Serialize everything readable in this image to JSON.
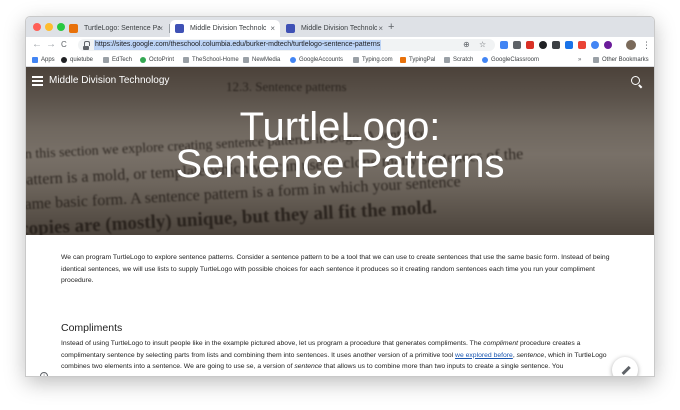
{
  "browser": {
    "tabs": [
      {
        "title": "TurtleLogo: Sentence Patterns",
        "close": "×",
        "active": false
      },
      {
        "title": "Middle Division Technology - T",
        "close": "×",
        "active": true
      },
      {
        "title": "Middle Division Technology - T",
        "close": "×",
        "active": false
      }
    ],
    "new_tab": "+",
    "back": "←",
    "forward": "→",
    "reload": "C",
    "url": "https://sites.google.com/theschool.columbia.edu/burker-mdtech/turtlelogo-sentence-patterns",
    "zoom_icon": "⊕",
    "star_icon": "☆",
    "menu": "⋮"
  },
  "bookmarks": [
    {
      "label": "Apps",
      "color": "#4285f4"
    },
    {
      "label": "quietube",
      "color": "#202124"
    },
    {
      "label": "EdTech",
      "color": "#9aa0a6"
    },
    {
      "label": "OctoPrint",
      "color": "#34a853"
    },
    {
      "label": "TheSchool-Home",
      "color": "#9aa0a6"
    },
    {
      "label": "NewMedia",
      "color": "#9aa0a6"
    },
    {
      "label": "GoogleAccounts",
      "color": "#4285f4"
    },
    {
      "label": "Typing.com",
      "color": "#9aa0a6"
    },
    {
      "label": "TypingPal",
      "color": "#e8710a"
    },
    {
      "label": "Scratch",
      "color": "#9aa0a6"
    },
    {
      "label": "GoogleClassroom",
      "color": "#4285f4"
    }
  ],
  "bookmarks_more": "»",
  "other_bookmarks": "Other Bookmarks",
  "site": {
    "title": "Middle Division Technology",
    "hero_title_line1": "TurtleLogo:",
    "hero_title_line2": "Sentence Patterns"
  },
  "hero_background_text": {
    "heading": "12.3.   Sentence patterns",
    "line1": "In this section we explore creating sentence patterns in Logo. A sentence",
    "line2": "pattern is a mold, or template which we can use to clone many sentences of the",
    "line3": "same basic form. A sentence pattern is a form in which your sentence",
    "line4": "copies are (mostly) unique, but they all fit the mold."
  },
  "content": {
    "intro": "We can program TurtleLogo to explore sentence patterns. Consider a sentence pattern to be a tool that we can use to create sentences that use the same basic form. Instead of being identical sentences, we will use lists to supply TurtleLogo with possible choices for each sentence it produces so it creating random sentences each time you run your compliment procedure.",
    "compliments_heading": "Compliments",
    "p2_a": "Instead of using TurtleLogo to insult people like in the example pictured above, let us program a procedure that generates compliments. The ",
    "p2_compliment": "compliment",
    "p2_b": " procedure creates a complimentary sentence by selecting parts from lists and combining them into sentences. It uses another version of a primitive tool ",
    "p2_link": "we explored before",
    "p2_c": ", ",
    "p2_sentence": "sentence",
    "p2_d": ", which in TurtleLogo combines two elements into a sentence. We are going to use se, a version of ",
    "p2_sentence2": "sentence",
    "p2_e": " that allows us to combine more than two inputs to create a single sentence. You"
  },
  "colors": {
    "accent_link": "#1a56b0",
    "tab_strip": "#dee1e6",
    "traffic_red": "#ff5f57",
    "traffic_yellow": "#febc2e",
    "traffic_green": "#28c840"
  }
}
